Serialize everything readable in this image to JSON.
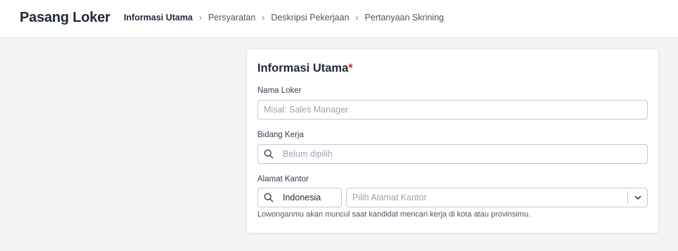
{
  "header": {
    "title": "Pasang Loker",
    "steps": [
      {
        "label": "Informasi Utama",
        "active": true
      },
      {
        "label": "Persyaratan",
        "active": false
      },
      {
        "label": "Deskripsi Pekerjaan",
        "active": false
      },
      {
        "label": "Pertanyaan Skrining",
        "active": false
      }
    ],
    "separator": "›"
  },
  "form": {
    "section_title": "Informasi Utama",
    "required_mark": "*",
    "job_name": {
      "label": "Nama Loker",
      "placeholder": "Misal: Sales Manager",
      "value": ""
    },
    "field": {
      "label": "Bidang Kerja",
      "placeholder": "Belum dipilih",
      "icon": "search-icon"
    },
    "address": {
      "label": "Alamat Kantor",
      "country_value": "Indonesia",
      "country_icon": "search-icon",
      "address_placeholder": "Pilih Alamat Kantor",
      "dropdown_icon": "chevron-down-icon",
      "hint": "Lowonganmu akan muncul saat kandidat mencari kerja di kota atau provinsimu."
    }
  },
  "colors": {
    "required": "#dc2626",
    "background": "#f3f4f6",
    "card": "#ffffff",
    "border": "#c4c9d0"
  }
}
